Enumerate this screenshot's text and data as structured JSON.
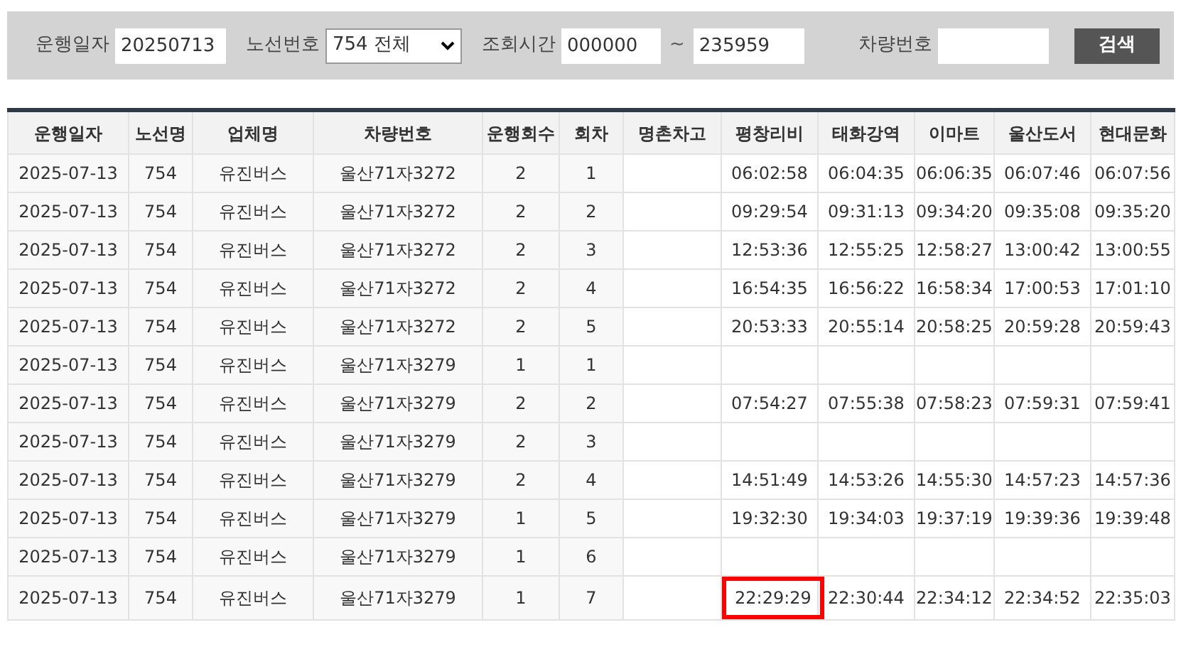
{
  "filters": [
    {
      "label": "운행일자",
      "kind": "input",
      "value": "20250713"
    },
    {
      "label": "노선번호",
      "kind": "select",
      "value": "754 전체"
    },
    {
      "label": "조회시간",
      "kind": "range",
      "value": "000000",
      "value_to": "235959",
      "separator": "~"
    },
    {
      "label": "차량번호",
      "kind": "input"
    }
  ],
  "search_button": "검색",
  "table": {
    "columns": [
      "운행일자",
      "노선명",
      "업체명",
      "차량번호",
      "운행회수",
      "회차",
      "명촌차고",
      "평창리비",
      "태화강역",
      "이마트",
      "울산도서",
      "현대문화"
    ],
    "rows": [
      {
        "cells": [
          "2025-07-13",
          "754",
          "유진버스",
          "울산71자3272",
          "2",
          "1"
        ],
        "times": [
          {
            "time": "06:02:58",
            "highlighted": false
          },
          {
            "time": "06:04:35",
            "highlighted": false
          },
          {
            "time": "06:06:35",
            "highlighted": false
          },
          {
            "time": "06:07:46",
            "highlighted": false
          },
          {
            "time": "06:07:56",
            "highlighted": false
          }
        ]
      },
      {
        "cells": [
          "2025-07-13",
          "754",
          "유진버스",
          "울산71자3272",
          "2",
          "2"
        ],
        "times": [
          {
            "time": "09:29:54",
            "highlighted": false
          },
          {
            "time": "09:31:13",
            "highlighted": false
          },
          {
            "time": "09:34:20",
            "highlighted": false
          },
          {
            "time": "09:35:08",
            "highlighted": false
          },
          {
            "time": "09:35:20",
            "highlighted": false
          }
        ]
      },
      {
        "cells": [
          "2025-07-13",
          "754",
          "유진버스",
          "울산71자3272",
          "2",
          "3"
        ],
        "times": [
          {
            "time": "12:53:36",
            "highlighted": false
          },
          {
            "time": "12:55:25",
            "highlighted": false
          },
          {
            "time": "12:58:27",
            "highlighted": false
          },
          {
            "time": "13:00:42",
            "highlighted": false
          },
          {
            "time": "13:00:55",
            "highlighted": false
          }
        ]
      },
      {
        "cells": [
          "2025-07-13",
          "754",
          "유진버스",
          "울산71자3272",
          "2",
          "4"
        ],
        "times": [
          {
            "time": "16:54:35",
            "highlighted": false
          },
          {
            "time": "16:56:22",
            "highlighted": false
          },
          {
            "time": "16:58:34",
            "highlighted": false
          },
          {
            "time": "17:00:53",
            "highlighted": false
          },
          {
            "time": "17:01:10",
            "highlighted": false
          }
        ]
      },
      {
        "cells": [
          "2025-07-13",
          "754",
          "유진버스",
          "울산71자3272",
          "2",
          "5"
        ],
        "times": [
          {
            "time": "20:53:33",
            "highlighted": false
          },
          {
            "time": "20:55:14",
            "highlighted": false
          },
          {
            "time": "20:58:25",
            "highlighted": false
          },
          {
            "time": "20:59:28",
            "highlighted": false
          },
          {
            "time": "20:59:43",
            "highlighted": false
          }
        ]
      },
      {
        "cells": [
          "2025-07-13",
          "754",
          "유진버스",
          "울산71자3279",
          "1",
          "1"
        ]
      },
      {
        "cells": [
          "2025-07-13",
          "754",
          "유진버스",
          "울산71자3279",
          "2",
          "2"
        ],
        "times": [
          {
            "time": "07:54:27",
            "highlighted": false
          },
          {
            "time": "07:55:38",
            "highlighted": false
          },
          {
            "time": "07:58:23",
            "highlighted": false
          },
          {
            "time": "07:59:31",
            "highlighted": false
          },
          {
            "time": "07:59:41",
            "highlighted": false
          }
        ]
      },
      {
        "cells": [
          "2025-07-13",
          "754",
          "유진버스",
          "울산71자3279",
          "2",
          "3"
        ]
      },
      {
        "cells": [
          "2025-07-13",
          "754",
          "유진버스",
          "울산71자3279",
          "2",
          "4"
        ],
        "times": [
          {
            "time": "14:51:49",
            "highlighted": false
          },
          {
            "time": "14:53:26",
            "highlighted": false
          },
          {
            "time": "14:55:30",
            "highlighted": false
          },
          {
            "time": "14:57:23",
            "highlighted": false
          },
          {
            "time": "14:57:36",
            "highlighted": false
          }
        ]
      },
      {
        "cells": [
          "2025-07-13",
          "754",
          "유진버스",
          "울산71자3279",
          "1",
          "5"
        ],
        "times": [
          {
            "time": "19:32:30",
            "highlighted": false
          },
          {
            "time": "19:34:03",
            "highlighted": false
          },
          {
            "time": "19:37:19",
            "highlighted": false
          },
          {
            "time": "19:39:36",
            "highlighted": false
          },
          {
            "time": "19:39:48",
            "highlighted": false
          }
        ]
      },
      {
        "cells": [
          "2025-07-13",
          "754",
          "유진버스",
          "울산71자3279",
          "1",
          "6"
        ]
      },
      {
        "cells": [
          "2025-07-13",
          "754",
          "유진버스",
          "울산71자3279",
          "1",
          "7"
        ],
        "times": [
          {
            "time": "22:29:29",
            "highlighted": true
          },
          {
            "time": "22:30:44",
            "highlighted": false
          },
          {
            "time": "22:34:12",
            "highlighted": false
          },
          {
            "time": "22:34:52",
            "highlighted": false
          },
          {
            "time": "22:35:03",
            "highlighted": false
          }
        ]
      }
    ]
  }
}
